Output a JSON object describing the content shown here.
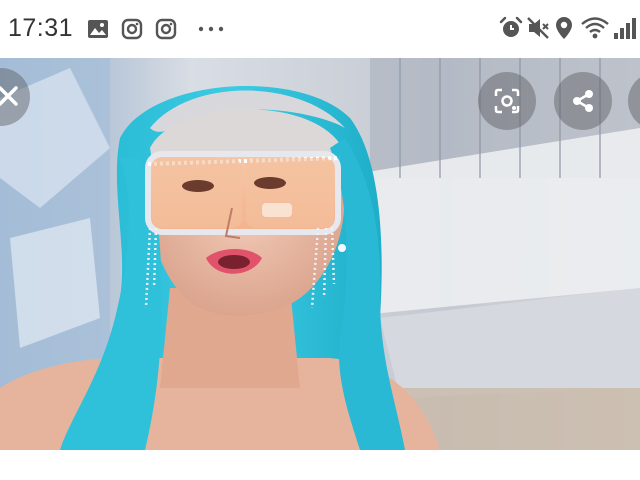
{
  "status_bar": {
    "time": "17:31",
    "left_icons": [
      "gallery-notification-icon",
      "instagram-icon",
      "instagram-icon",
      "more-notifications-icon"
    ],
    "right_icons": [
      "alarm-icon",
      "mute-icon",
      "location-icon",
      "wifi-icon",
      "signal-icon"
    ]
  },
  "viewer": {
    "buttons": [
      "close-icon",
      "lens-search-icon",
      "share-icon",
      "more-icon"
    ],
    "colors": {
      "hair": "#2ec4dc",
      "background": "#c7cbd3",
      "skin": "#e8b8a4"
    }
  }
}
